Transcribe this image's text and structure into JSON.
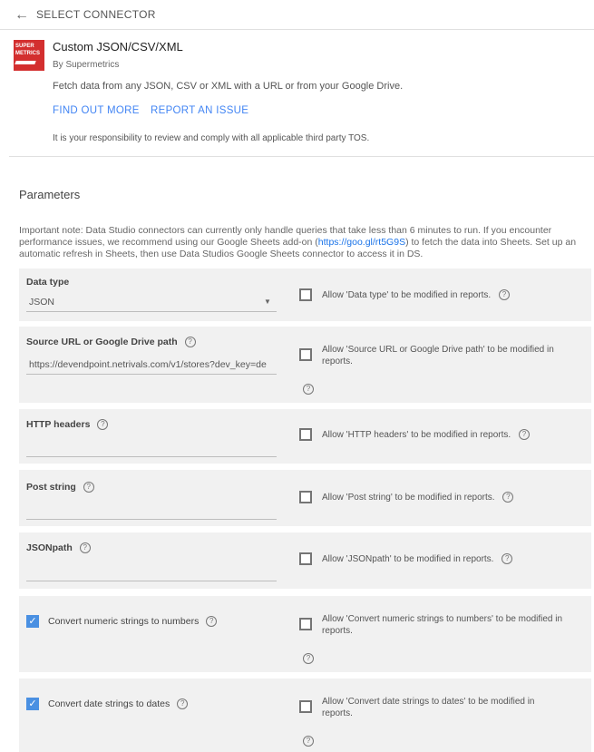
{
  "header": {
    "back_icon": "arrow-left-icon",
    "title": "SELECT CONNECTOR"
  },
  "connector": {
    "logo_text_1": "SUPER",
    "logo_text_2": "METRICS",
    "name": "Custom JSON/CSV/XML",
    "by": "By Supermetrics",
    "description": "Fetch data from any JSON, CSV or XML with a URL or from your Google Drive.",
    "find_out_more": "FIND OUT MORE",
    "report_issue": "REPORT AN ISSUE",
    "tos": "It is your responsibility to review and comply with all applicable third party TOS."
  },
  "parameters": {
    "title": "Parameters",
    "note_before": "Important note: Data Studio connectors can currently only handle queries that take less than 6 minutes to run. If you encounter performance issues, we recommend using our Google Sheets add-on (",
    "note_link": "https://goo.gl/rt5G9S",
    "note_after": ") to fetch the data into Sheets. Set up an automatic refresh in Sheets, then use Data Studios Google Sheets connector to access it in DS.",
    "help_glyph": "?",
    "data_type": {
      "label": "Data type",
      "value": "JSON",
      "allow": "Allow 'Data type' to be modified in reports."
    },
    "source_url": {
      "label": "Source URL or Google Drive path",
      "value": "https://devendpoint.netrivals.com/v1/stores?dev_key=de",
      "allow": "Allow 'Source URL or Google Drive path' to be modified in reports."
    },
    "http_headers": {
      "label": "HTTP headers",
      "value": "",
      "allow": "Allow 'HTTP headers' to be modified in reports."
    },
    "post_string": {
      "label": "Post string",
      "value": "",
      "allow": "Allow 'Post string' to be modified in reports."
    },
    "jsonpath": {
      "label": "JSONpath",
      "value": "",
      "allow": "Allow 'JSONpath' to be modified in reports."
    },
    "convert_numeric": {
      "label": "Convert numeric strings to numbers",
      "checked": true,
      "allow": "Allow 'Convert numeric strings to numbers' to be modified in reports."
    },
    "convert_dates": {
      "label": "Convert date strings to dates",
      "checked": true,
      "allow": "Allow 'Convert date strings to dates' to be modified in reports."
    }
  },
  "colors": {
    "accent": "#4285f4",
    "checkbox_on": "#4a90e2",
    "logo": "#d32f2f",
    "panel": "#f1f1f1"
  }
}
